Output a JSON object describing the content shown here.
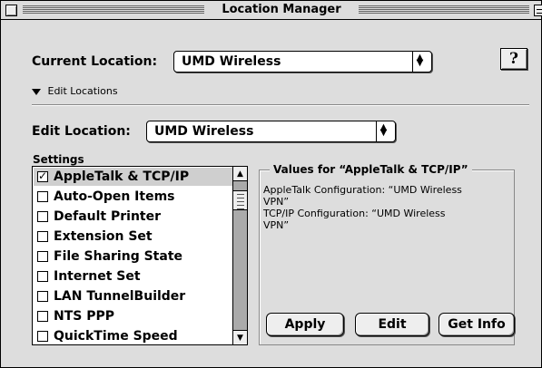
{
  "window": {
    "title": "Location Manager"
  },
  "current_location": {
    "label": "Current Location:",
    "value": "UMD Wireless",
    "help": "?"
  },
  "edit_locations_toggle": {
    "label": "Edit Locations"
  },
  "edit_location": {
    "label": "Edit Location:",
    "value": "UMD Wireless"
  },
  "settings": {
    "label": "Settings",
    "items": [
      {
        "label": "AppleTalk & TCP/IP",
        "checked": true,
        "selected": true
      },
      {
        "label": "Auto-Open Items",
        "checked": false,
        "selected": false
      },
      {
        "label": "Default Printer",
        "checked": false,
        "selected": false
      },
      {
        "label": "Extension Set",
        "checked": false,
        "selected": false
      },
      {
        "label": "File Sharing State",
        "checked": false,
        "selected": false
      },
      {
        "label": "Internet Set",
        "checked": false,
        "selected": false
      },
      {
        "label": "LAN TunnelBuilder",
        "checked": false,
        "selected": false
      },
      {
        "label": "NTS PPP",
        "checked": false,
        "selected": false
      },
      {
        "label": "QuickTime Speed",
        "checked": false,
        "selected": false
      }
    ]
  },
  "values_panel": {
    "title": "Values for “AppleTalk & TCP/IP”",
    "lines": [
      "AppleTalk Configuration: “UMD Wireless",
      "VPN”",
      "TCP/IP Configuration: “UMD Wireless",
      "VPN”"
    ]
  },
  "buttons": {
    "apply": "Apply",
    "edit": "Edit",
    "get_info": "Get Info"
  },
  "icons": {
    "close_box": "close-box-icon",
    "collapse_box": "collapse-box-icon",
    "popup_arrows": "up-down-arrows-icon",
    "disclosure": "disclosure-triangle-down-icon",
    "scroll_up": "scroll-up-arrow-icon",
    "scroll_down": "scroll-down-arrow-icon"
  }
}
